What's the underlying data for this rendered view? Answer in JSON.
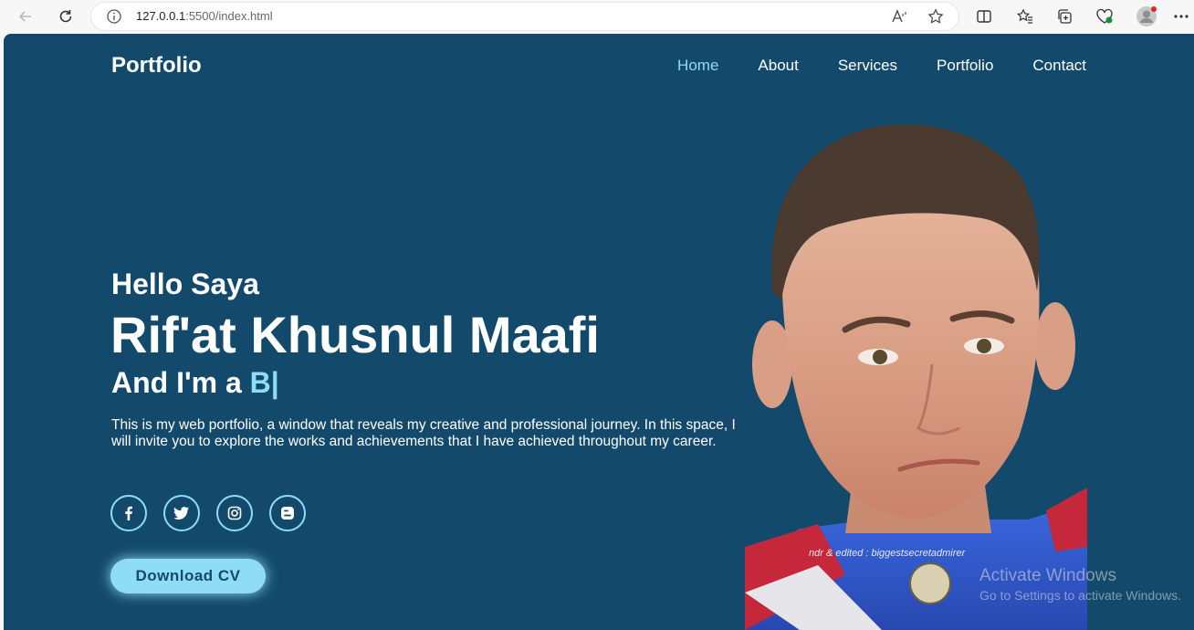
{
  "browser": {
    "url_host": "127.0.0.1",
    "url_rest": ":5500/index.html"
  },
  "header": {
    "logo": "Portfolio",
    "nav": [
      {
        "label": "Home",
        "active": true
      },
      {
        "label": "About"
      },
      {
        "label": "Services"
      },
      {
        "label": "Portfolio"
      },
      {
        "label": "Contact"
      }
    ]
  },
  "hero": {
    "greeting": "Hello Saya",
    "name": "Rif'at Khusnul Maafi",
    "role_prefix": "And I'm a ",
    "role_typed": "B|",
    "description": "This is my web portfolio, a window that reveals my creative and professional journey. In this space, I will invite you to explore the works and achievements that I have achieved throughout my career.",
    "socials": [
      "facebook-icon",
      "twitter-icon",
      "instagram-icon",
      "blogger-icon"
    ],
    "cv_button": "Download CV",
    "photo_caption": "ndr & edited : biggestsecretadmirer"
  },
  "watermark": {
    "line1": "Activate Windows",
    "line2": "Go to Settings to activate Windows."
  },
  "colors": {
    "background": "#134a6c",
    "accent": "#8fdcf6"
  }
}
